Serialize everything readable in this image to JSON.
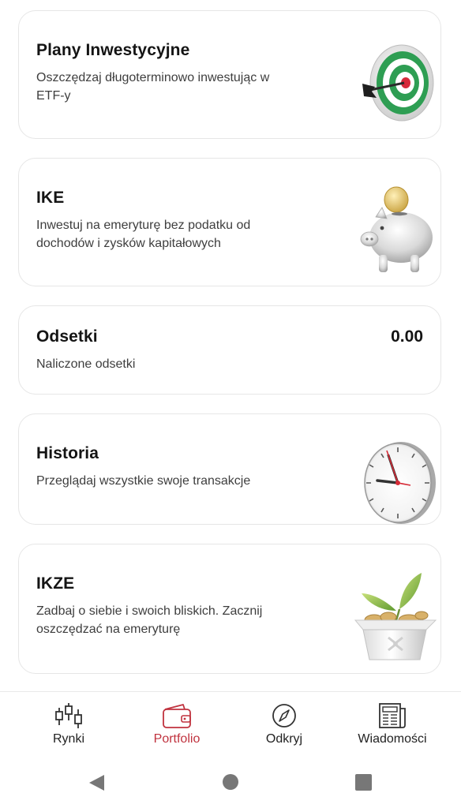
{
  "cards": {
    "plany": {
      "title": "Plany Inwestycyjne",
      "description": "Oszczędzaj długoterminowo inwestując w ETF-y"
    },
    "ike": {
      "title": "IKE",
      "description": "Inwestuj na emeryturę bez podatku od dochodów i zysków kapitałowych"
    },
    "odsetki": {
      "title": "Odsetki",
      "description": "Naliczone odsetki",
      "value": "0.00"
    },
    "historia": {
      "title": "Historia",
      "description": "Przeglądaj wszystkie swoje transakcje"
    },
    "ikze": {
      "title": "IKZE",
      "description": "Zadbaj o siebie i swoich bliskich. Zacznij oszczędzać na emeryturę"
    }
  },
  "bottom_nav": {
    "items": [
      {
        "label": "Rynki",
        "icon": "candlestick-icon"
      },
      {
        "label": "Portfolio",
        "icon": "wallet-icon",
        "active": true
      },
      {
        "label": "Odkryj",
        "icon": "compass-icon"
      },
      {
        "label": "Wiadomości",
        "icon": "newspaper-icon"
      }
    ],
    "active_color": "#c0323e"
  },
  "system_nav": {
    "buttons": [
      "back-icon",
      "home-icon",
      "recents-icon"
    ]
  }
}
